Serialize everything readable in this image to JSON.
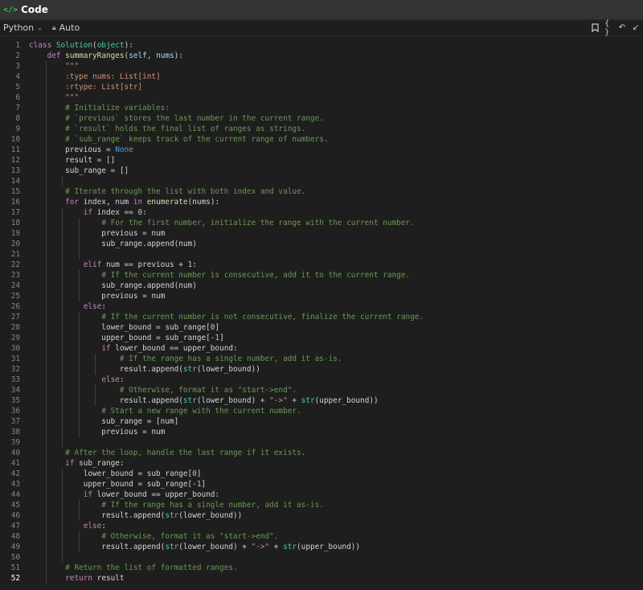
{
  "titlebar": {
    "icon": "</>",
    "title": "Code"
  },
  "toolbar": {
    "language": "Python",
    "mode": "Auto"
  },
  "colors": {
    "background": "#1e1e1e",
    "keyword": "#c586c0",
    "builtin_constant": "#569cd6",
    "class_name": "#4ec9b0",
    "function": "#dcdcaa",
    "string": "#ce9178",
    "comment": "#6a9955",
    "number": "#b5cea8",
    "variable": "#9cdcfe"
  },
  "active_line": 52,
  "code_lines": [
    [
      [
        "k",
        "class"
      ],
      [
        "t",
        " "
      ],
      [
        "cl",
        "Solution"
      ],
      [
        "t",
        "("
      ],
      [
        "cl",
        "object"
      ],
      [
        "t",
        "):"
      ]
    ],
    [
      [
        "t",
        "    "
      ],
      [
        "k",
        "def"
      ],
      [
        "t",
        " "
      ],
      [
        "fn",
        "summaryRanges"
      ],
      [
        "t",
        "("
      ],
      [
        "va",
        "self"
      ],
      [
        "t",
        ", "
      ],
      [
        "va",
        "nums"
      ],
      [
        "t",
        "):"
      ]
    ],
    [
      [
        "t",
        "        "
      ],
      [
        "st",
        "\"\"\""
      ]
    ],
    [
      [
        "t",
        "        "
      ],
      [
        "st",
        ":type nums: List[int]"
      ]
    ],
    [
      [
        "t",
        "        "
      ],
      [
        "st",
        ":rtype: List[str]"
      ]
    ],
    [
      [
        "t",
        "        "
      ],
      [
        "st",
        "\"\"\""
      ]
    ],
    [
      [
        "t",
        "        "
      ],
      [
        "cm",
        "# Initialize variables:"
      ]
    ],
    [
      [
        "t",
        "        "
      ],
      [
        "cm",
        "# `previous` stores the last number in the current range."
      ]
    ],
    [
      [
        "t",
        "        "
      ],
      [
        "cm",
        "# `result` holds the final list of ranges as strings."
      ]
    ],
    [
      [
        "t",
        "        "
      ],
      [
        "cm",
        "# `sub_range` keeps track of the current range of numbers."
      ]
    ],
    [
      [
        "t",
        "        previous = "
      ],
      [
        "kb",
        "None"
      ]
    ],
    [
      [
        "t",
        "        result = []"
      ]
    ],
    [
      [
        "t",
        "        sub_range = []"
      ]
    ],
    [],
    [
      [
        "t",
        "        "
      ],
      [
        "cm",
        "# Iterate through the list with both index and value."
      ]
    ],
    [
      [
        "t",
        "        "
      ],
      [
        "k",
        "for"
      ],
      [
        "t",
        " index, num "
      ],
      [
        "k",
        "in"
      ],
      [
        "t",
        " "
      ],
      [
        "fn",
        "enumerate"
      ],
      [
        "t",
        "(nums):"
      ]
    ],
    [
      [
        "t",
        "            "
      ],
      [
        "k",
        "if"
      ],
      [
        "t",
        " index == "
      ],
      [
        "nu",
        "0"
      ],
      [
        "t",
        ":"
      ]
    ],
    [
      [
        "t",
        "                "
      ],
      [
        "cm",
        "# For the first number, initialize the range with the current number."
      ]
    ],
    [
      [
        "t",
        "                previous = num"
      ]
    ],
    [
      [
        "t",
        "                sub_range.append(num)"
      ]
    ],
    [],
    [
      [
        "t",
        "            "
      ],
      [
        "k",
        "elif"
      ],
      [
        "t",
        " num == previous + "
      ],
      [
        "nu",
        "1"
      ],
      [
        "t",
        ":"
      ]
    ],
    [
      [
        "t",
        "                "
      ],
      [
        "cm",
        "# If the current number is consecutive, add it to the current range."
      ]
    ],
    [
      [
        "t",
        "                sub_range.append(num)"
      ]
    ],
    [
      [
        "t",
        "                previous = num"
      ]
    ],
    [
      [
        "t",
        "            "
      ],
      [
        "k",
        "else"
      ],
      [
        "t",
        ":"
      ]
    ],
    [
      [
        "t",
        "                "
      ],
      [
        "cm",
        "# If the current number is not consecutive, finalize the current range."
      ]
    ],
    [
      [
        "t",
        "                lower_bound = sub_range["
      ],
      [
        "nu",
        "0"
      ],
      [
        "t",
        "]"
      ]
    ],
    [
      [
        "t",
        "                upper_bound = sub_range[-"
      ],
      [
        "nu",
        "1"
      ],
      [
        "t",
        "]"
      ]
    ],
    [
      [
        "t",
        "                "
      ],
      [
        "k",
        "if"
      ],
      [
        "t",
        " lower_bound == upper_bound:"
      ]
    ],
    [
      [
        "t",
        "                    "
      ],
      [
        "cm",
        "# If the range has a single number, add it as-is."
      ]
    ],
    [
      [
        "t",
        "                    result.append("
      ],
      [
        "cl",
        "str"
      ],
      [
        "t",
        "(lower_bound))"
      ]
    ],
    [
      [
        "t",
        "                "
      ],
      [
        "k",
        "else"
      ],
      [
        "t",
        ":"
      ]
    ],
    [
      [
        "t",
        "                    "
      ],
      [
        "cm",
        "# Otherwise, format it as \"start->end\"."
      ]
    ],
    [
      [
        "t",
        "                    result.append("
      ],
      [
        "cl",
        "str"
      ],
      [
        "t",
        "(lower_bound) + "
      ],
      [
        "st",
        "\"->\""
      ],
      [
        "t",
        " + "
      ],
      [
        "cl",
        "str"
      ],
      [
        "t",
        "(upper_bound))"
      ]
    ],
    [
      [
        "t",
        "                "
      ],
      [
        "cm",
        "# Start a new range with the current number."
      ]
    ],
    [
      [
        "t",
        "                sub_range = [num]"
      ]
    ],
    [
      [
        "t",
        "                previous = num"
      ]
    ],
    [],
    [
      [
        "t",
        "        "
      ],
      [
        "cm",
        "# After the loop, handle the last range if it exists."
      ]
    ],
    [
      [
        "t",
        "        "
      ],
      [
        "k",
        "if"
      ],
      [
        "t",
        " sub_range:"
      ]
    ],
    [
      [
        "t",
        "            lower_bound = sub_range["
      ],
      [
        "nu",
        "0"
      ],
      [
        "t",
        "]"
      ]
    ],
    [
      [
        "t",
        "            upper_bound = sub_range[-"
      ],
      [
        "nu",
        "1"
      ],
      [
        "t",
        "]"
      ]
    ],
    [
      [
        "t",
        "            "
      ],
      [
        "k",
        "if"
      ],
      [
        "t",
        " lower_bound == upper_bound:"
      ]
    ],
    [
      [
        "t",
        "                "
      ],
      [
        "cm",
        "# If the range has a single number, add it as-is."
      ]
    ],
    [
      [
        "t",
        "                result.append("
      ],
      [
        "cl",
        "str"
      ],
      [
        "t",
        "(lower_bound))"
      ]
    ],
    [
      [
        "t",
        "            "
      ],
      [
        "k",
        "else"
      ],
      [
        "t",
        ":"
      ]
    ],
    [
      [
        "t",
        "                "
      ],
      [
        "cm",
        "# Otherwise, format it as \"start->end\"."
      ]
    ],
    [
      [
        "t",
        "                result.append("
      ],
      [
        "cl",
        "str"
      ],
      [
        "t",
        "(lower_bound) + "
      ],
      [
        "st",
        "\"->\""
      ],
      [
        "t",
        " + "
      ],
      [
        "cl",
        "str"
      ],
      [
        "t",
        "(upper_bound))"
      ]
    ],
    [],
    [
      [
        "t",
        "        "
      ],
      [
        "cm",
        "# Return the list of formatted ranges."
      ]
    ],
    [
      [
        "t",
        "        "
      ],
      [
        "k",
        "return"
      ],
      [
        "t",
        " result"
      ]
    ]
  ]
}
